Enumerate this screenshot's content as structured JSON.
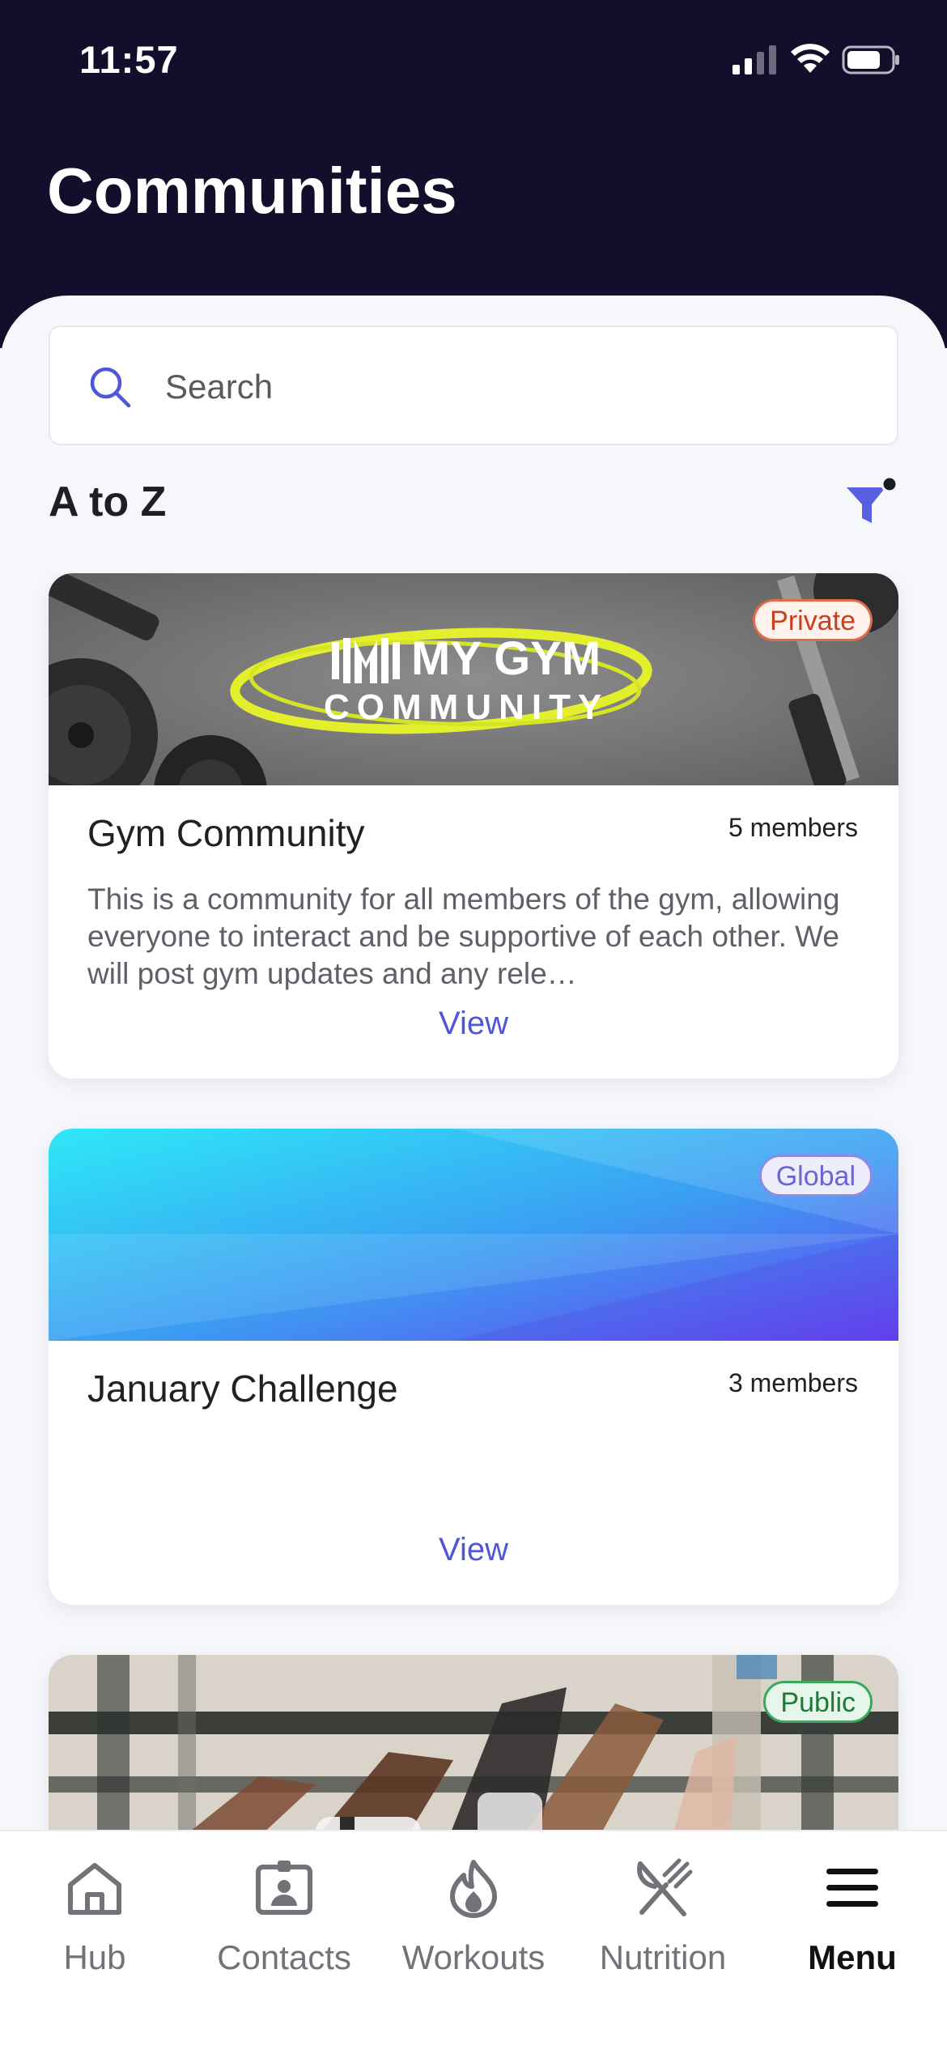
{
  "status_bar": {
    "time": "11:57"
  },
  "page": {
    "title": "Communities"
  },
  "search": {
    "placeholder": "Search"
  },
  "sort": {
    "label": "A to Z"
  },
  "colors": {
    "header_bg": "#140d2b",
    "accent": "#4f57d8",
    "private": "#e26a45",
    "global": "#8f89e6",
    "public": "#3aa85a"
  },
  "communities": [
    {
      "name": "Gym Community",
      "members": "5 members",
      "badge": "Private",
      "banner_logo_line1": "MY GYM",
      "banner_logo_line2": "COMMUNITY",
      "description": "This is a community for all members of the gym, allowing everyone to interact and be supportive of each other. We will post gym updates and any rele…",
      "view_label": "View"
    },
    {
      "name": "January Challenge",
      "members": "3 members",
      "badge": "Global",
      "description": "",
      "view_label": "View"
    },
    {
      "badge": "Public"
    }
  ],
  "tabs": [
    {
      "label": "Hub",
      "icon": "home-icon"
    },
    {
      "label": "Contacts",
      "icon": "contacts-icon"
    },
    {
      "label": "Workouts",
      "icon": "flame-icon"
    },
    {
      "label": "Nutrition",
      "icon": "utensils-icon"
    },
    {
      "label": "Menu",
      "icon": "menu-icon",
      "active": true
    }
  ]
}
